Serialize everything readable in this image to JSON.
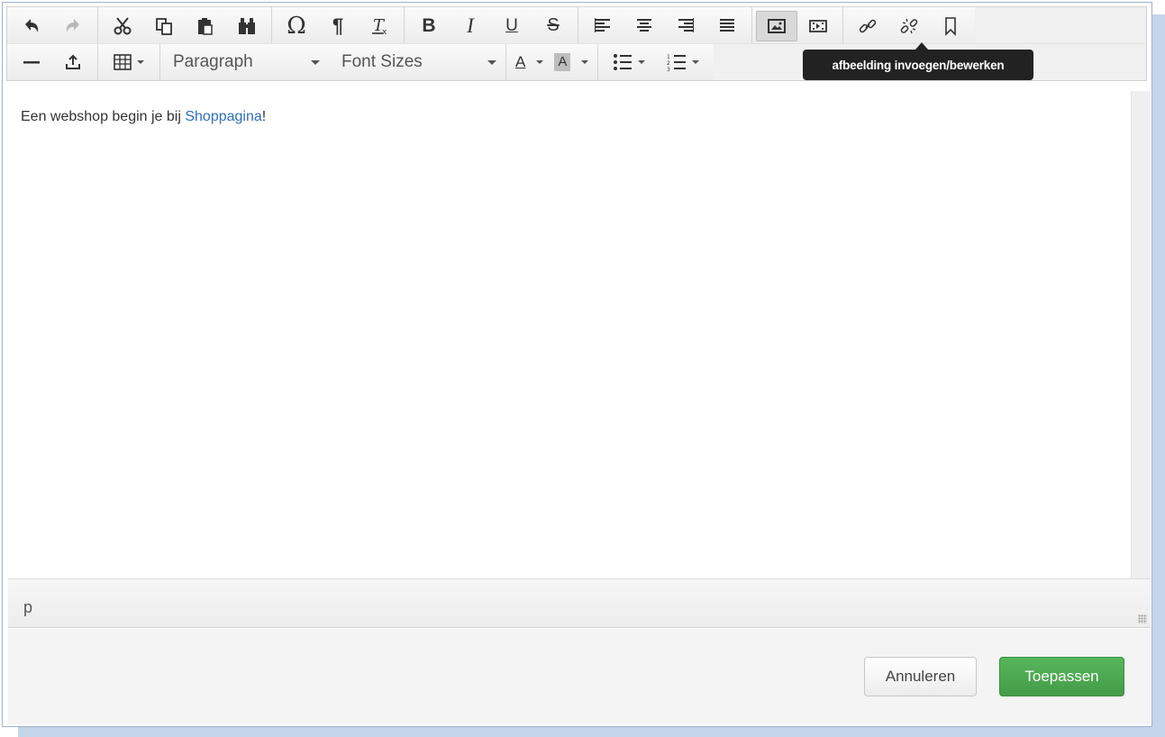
{
  "toolbar": {
    "format_dropdown": "Paragraph",
    "size_dropdown": "Font Sizes",
    "text_color_label": "A",
    "bg_color_label": "A",
    "tooltip": "afbeelding invoegen/bewerken"
  },
  "editor": {
    "text_before_link": "Een webshop begin je bij ",
    "link_text": "Shoppagina",
    "text_after_link": "!"
  },
  "statusbar": {
    "path": "p"
  },
  "footer": {
    "cancel_label": "Annuleren",
    "apply_label": "Toepassen"
  },
  "colors": {
    "apply_button": "#4cae51",
    "link": "#2f6fb8",
    "tooltip_bg": "#222222"
  }
}
